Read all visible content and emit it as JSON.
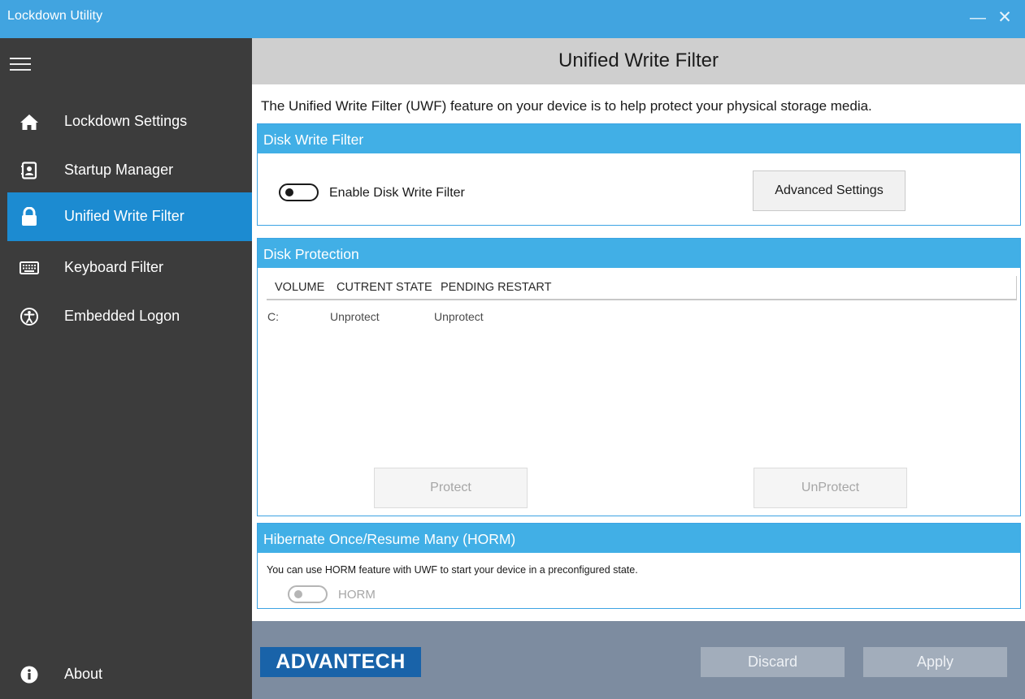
{
  "window": {
    "title": "Lockdown Utility",
    "minimize_glyph": "—",
    "close_glyph": "✕"
  },
  "sidebar": {
    "items": [
      {
        "label": "Lockdown Settings",
        "icon": "home-icon",
        "active": false
      },
      {
        "label": "Startup Manager",
        "icon": "contact-book-icon",
        "active": false
      },
      {
        "label": "Unified Write Filter",
        "icon": "lock-icon",
        "active": true
      },
      {
        "label": "Keyboard Filter",
        "icon": "keyboard-icon",
        "active": false
      },
      {
        "label": "Embedded Logon",
        "icon": "accessibility-icon",
        "active": false
      }
    ],
    "about": {
      "label": "About",
      "icon": "info-icon"
    }
  },
  "header": {
    "title": "Unified Write Filter"
  },
  "intro": "The Unified Write Filter (UWF) feature on your device is to help protect your physical storage media.",
  "disk_write_filter": {
    "heading": "Disk Write Filter",
    "toggle_label": "Enable Disk Write Filter",
    "toggle_on": false,
    "advanced_button": "Advanced Settings"
  },
  "disk_protection": {
    "heading": "Disk Protection",
    "columns": [
      "VOLUME",
      "CUTRENT STATE",
      "PENDING RESTART"
    ],
    "rows": [
      {
        "volume": "C:",
        "current_state": "Unprotect",
        "pending_restart": "Unprotect"
      }
    ],
    "protect_button": "Protect",
    "unprotect_button": "UnProtect"
  },
  "horm": {
    "heading": "Hibernate Once/Resume Many (HORM)",
    "description": "You can use HORM feature with UWF to start your device in a preconfigured state.",
    "toggle_label": "HORM",
    "toggle_on": false
  },
  "footer": {
    "logo_text": "ADVANTECH",
    "discard_button": "Discard",
    "apply_button": "Apply"
  },
  "colors": {
    "titlebar": "#41a4e0",
    "sidebar_bg": "#3c3c3c",
    "sidebar_active": "#1c8bd1",
    "panel_header": "#41afe6",
    "footer_bg": "#7d8ca0",
    "logo_bg": "#1963a9"
  }
}
